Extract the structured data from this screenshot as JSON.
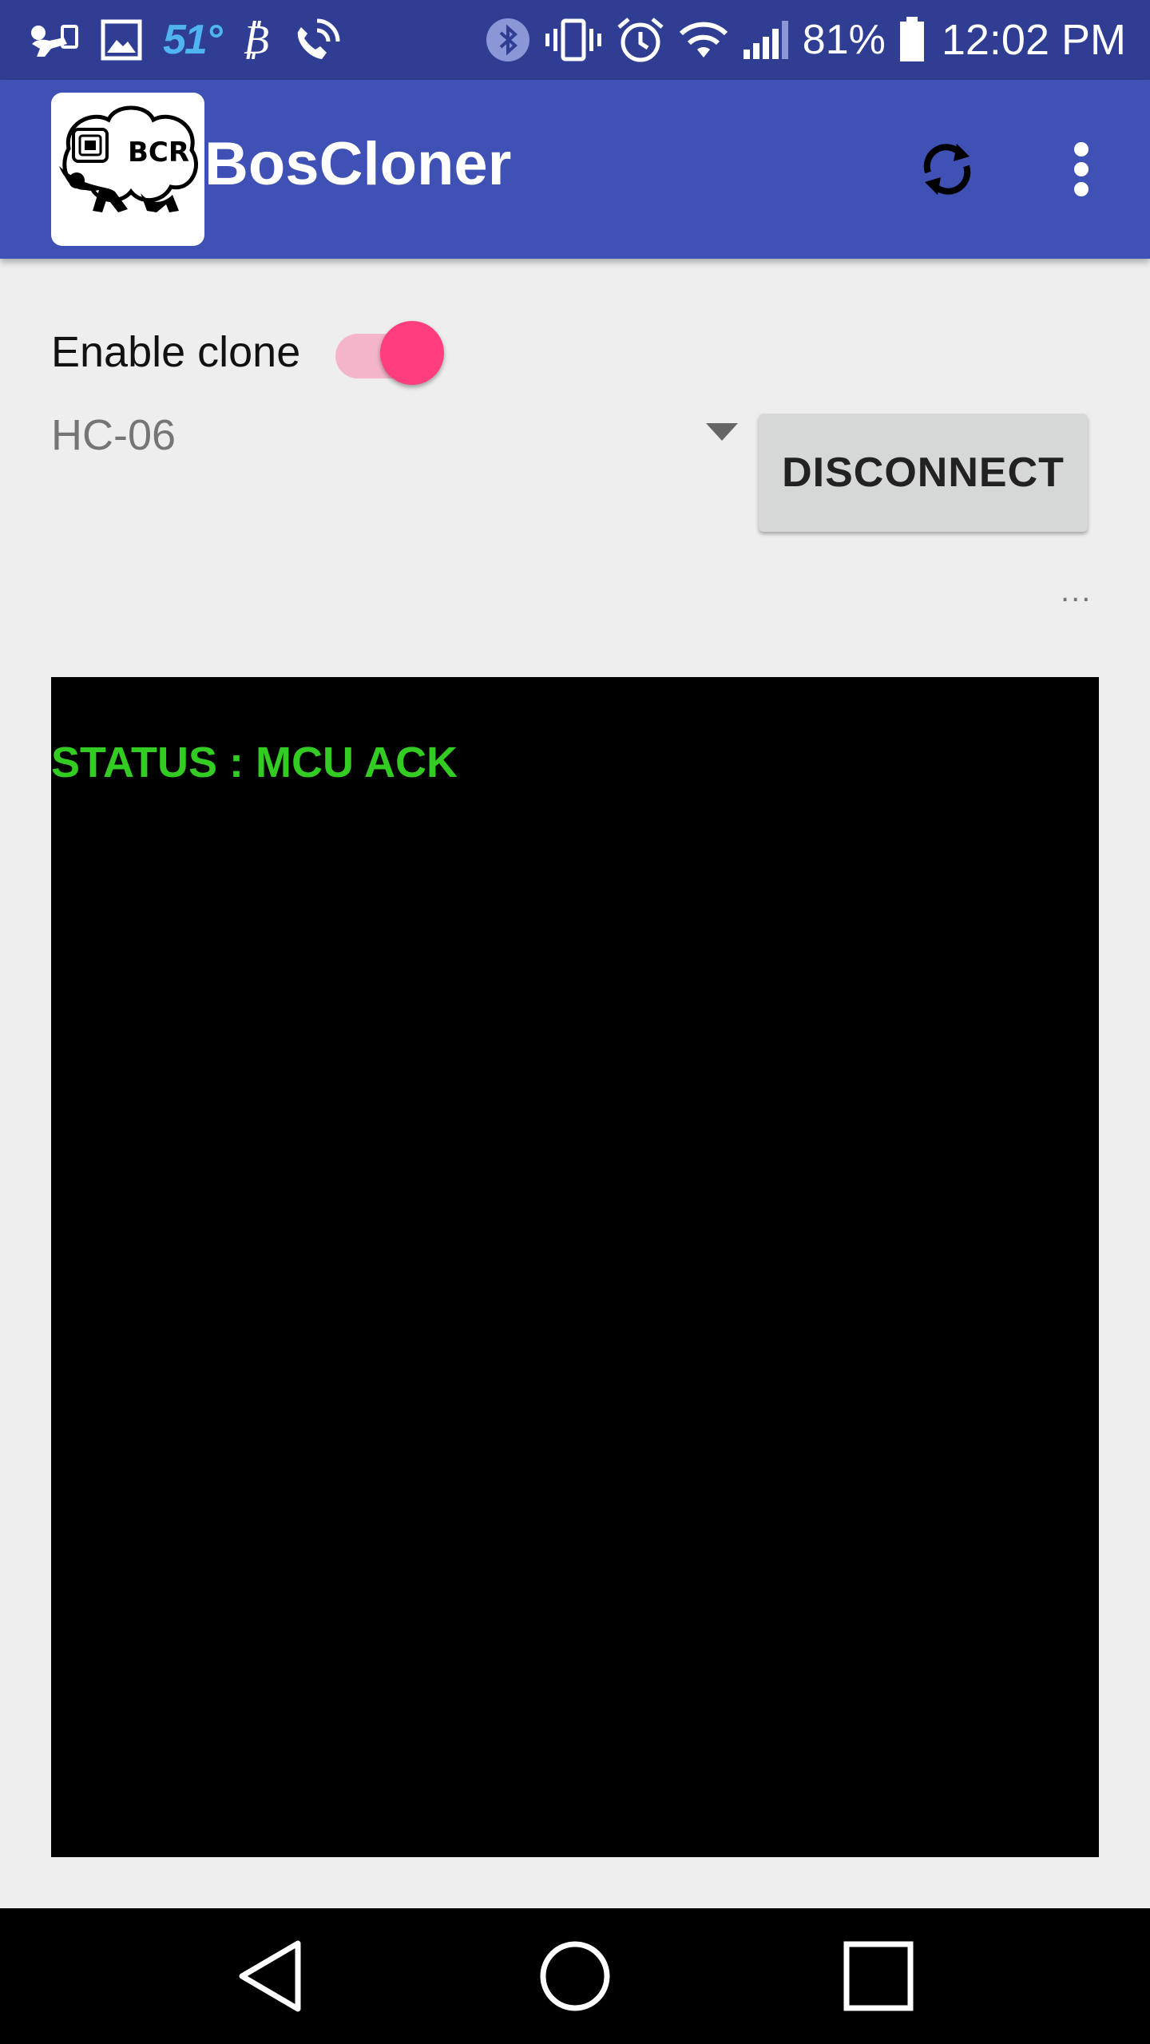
{
  "status_bar": {
    "left_icons": [
      "baby-monitor-icon",
      "image-icon",
      "weather-temp",
      "bitcoin-icon",
      "wifi-calling-icon"
    ],
    "temperature": "51°",
    "bitcoin_symbol": "₿",
    "right_icons": [
      "bluetooth-icon",
      "vibrate-icon",
      "alarm-icon",
      "wifi-icon",
      "signal-icon",
      "battery-icon"
    ],
    "battery_percent": "81%",
    "time": "12:02 PM"
  },
  "app_bar": {
    "title": "BosCloner",
    "logo_text": "BCR",
    "background_color": "#3F51B5",
    "actions": [
      "sync-icon",
      "more-vert-icon"
    ]
  },
  "controls": {
    "enable_clone_label": "Enable clone",
    "enable_clone_on": true,
    "device_selected": "HC-06",
    "disconnect_label": "DISCONNECT",
    "overflow_text": "..."
  },
  "terminal": {
    "status_line": "STATUS : MCU ACK",
    "text_color": "#33CC22"
  },
  "nav_bar": {
    "buttons": [
      "back-icon",
      "home-icon",
      "recents-icon"
    ]
  }
}
